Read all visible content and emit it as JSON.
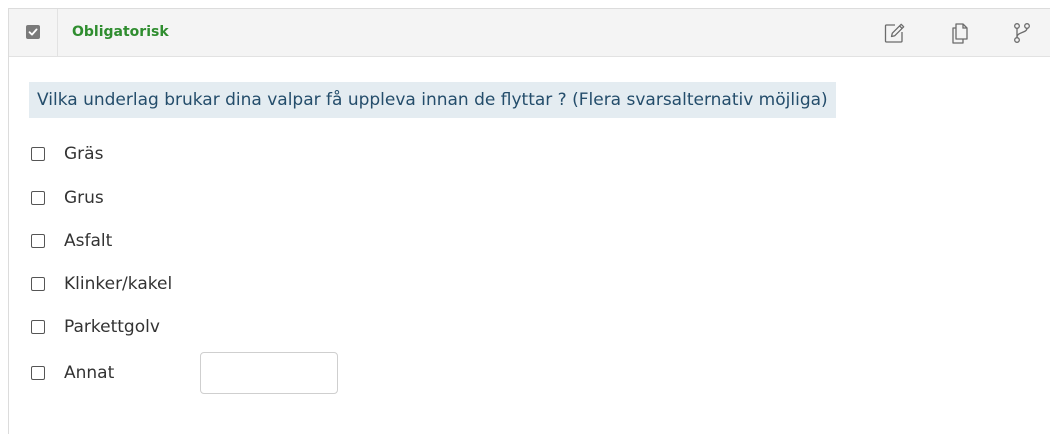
{
  "header": {
    "title": "Obligatorisk",
    "checked": true,
    "title_color": "#2f8d2f",
    "actions": [
      {
        "icon": "edit-icon"
      },
      {
        "icon": "copy-icon"
      },
      {
        "icon": "branch-icon"
      }
    ]
  },
  "question": {
    "text": "Vilka underlag brukar dina valpar få uppleva innan de flyttar ? (Flera svarsalternativ möjliga)",
    "background": "#e4ecf1",
    "color": "#244d6b"
  },
  "options": [
    {
      "label": "Gräs",
      "checked": false
    },
    {
      "label": "Grus",
      "checked": false
    },
    {
      "label": "Asfalt",
      "checked": false
    },
    {
      "label": "Klinker/kakel",
      "checked": false
    },
    {
      "label": "Parkettgolv",
      "checked": false
    },
    {
      "label": "Annat",
      "checked": false
    }
  ],
  "other_input": {
    "value": "",
    "placeholder": ""
  }
}
